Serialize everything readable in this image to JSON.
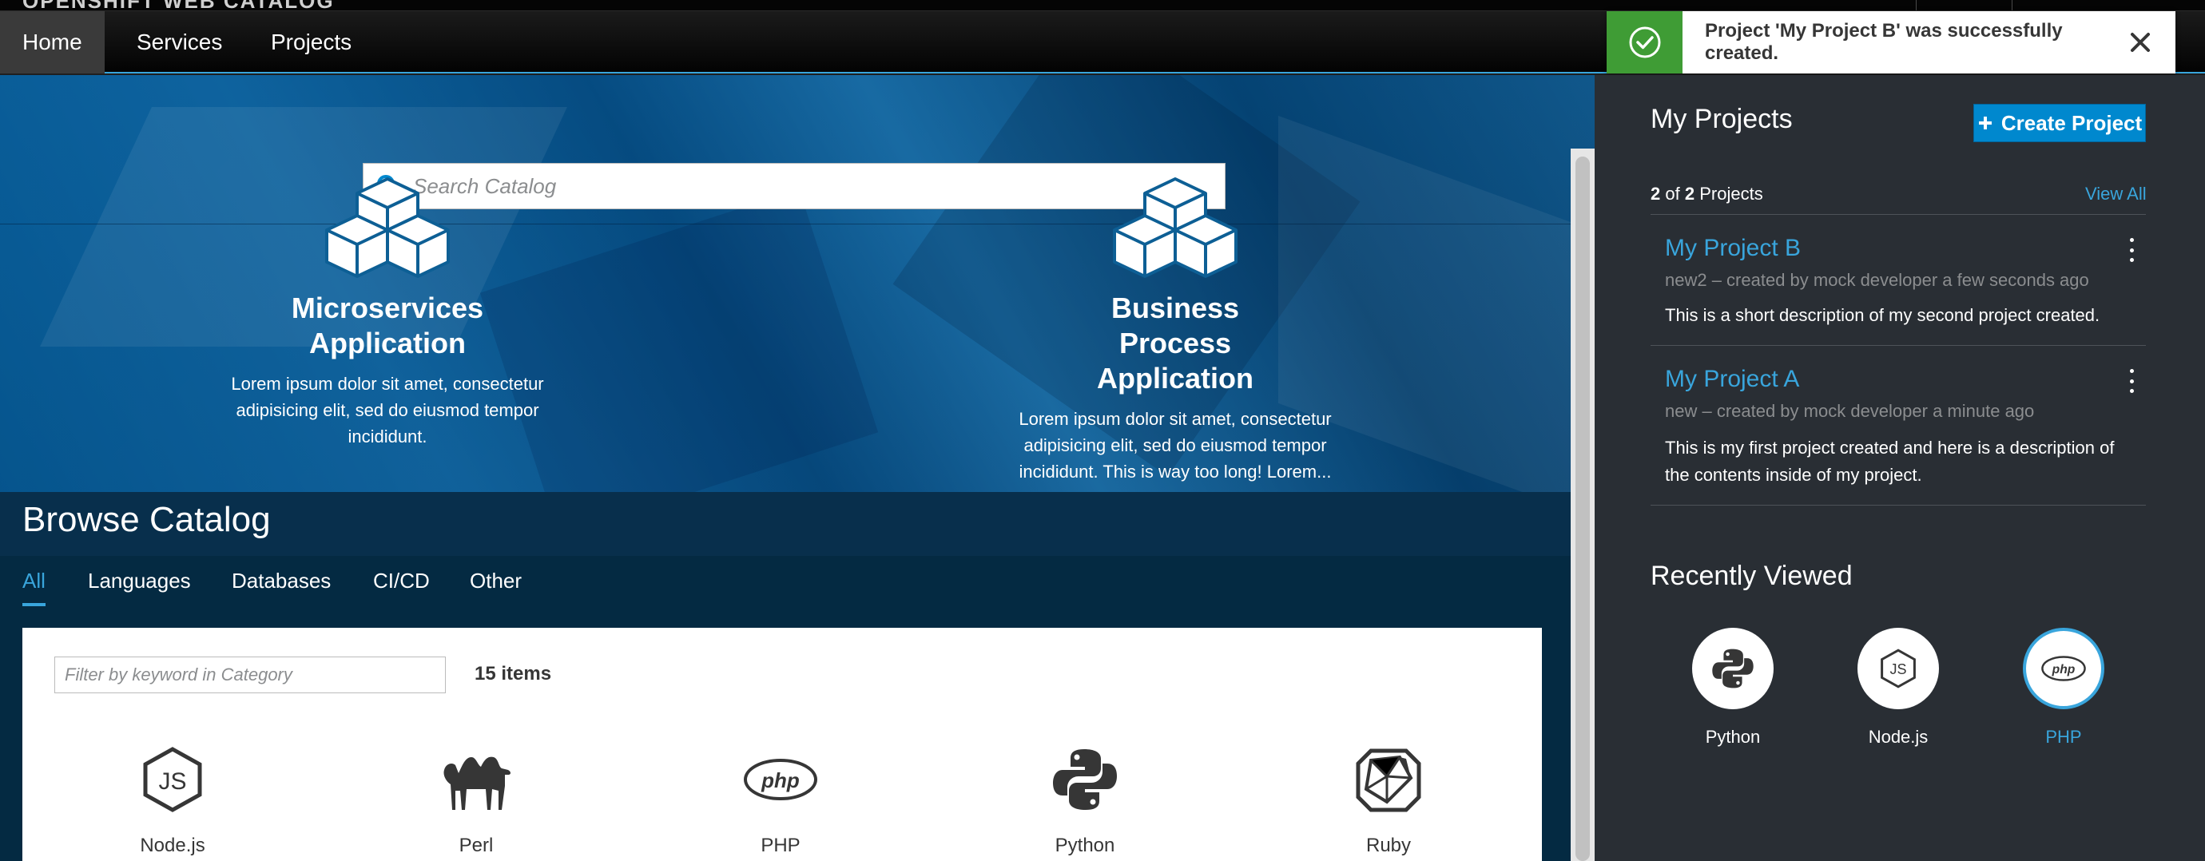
{
  "brand": {
    "text": "OPENSHIFT WEB CATALOG"
  },
  "nav": {
    "items": [
      {
        "label": "Home",
        "active": true
      },
      {
        "label": "Services",
        "active": false
      },
      {
        "label": "Projects",
        "active": false
      }
    ]
  },
  "toast": {
    "message": "Project 'My Project B' was successfully created.",
    "status_icon": "check-circle-icon",
    "close_icon": "close-icon",
    "status_color": "#3f9c35"
  },
  "search": {
    "placeholder": "Search Catalog",
    "value": ""
  },
  "features": [
    {
      "title": "Microservices Application",
      "text": "Lorem ipsum dolor sit amet, consectetur adipisicing elit, sed do eiusmod tempor incididunt.",
      "icon": "cubes-icon"
    },
    {
      "title": "Business Process Application",
      "text": "Lorem ipsum dolor sit amet, consectetur adipisicing elit, sed do eiusmod tempor incididunt. This is way too long! Lorem...",
      "icon": "cubes-icon"
    }
  ],
  "browse": {
    "title": "Browse Catalog",
    "tabs": [
      {
        "label": "All",
        "active": true
      },
      {
        "label": "Languages",
        "active": false
      },
      {
        "label": "Databases",
        "active": false
      },
      {
        "label": "CI/CD",
        "active": false
      },
      {
        "label": "Other",
        "active": false
      }
    ],
    "filter_placeholder": "Filter by keyword in Category",
    "items_count": "15 items",
    "items": [
      {
        "label": "Node.js",
        "icon": "nodejs-icon"
      },
      {
        "label": "Perl",
        "icon": "camel-icon"
      },
      {
        "label": "PHP",
        "icon": "php-icon"
      },
      {
        "label": "Python",
        "icon": "python-icon"
      },
      {
        "label": "Ruby",
        "icon": "ruby-icon"
      }
    ]
  },
  "side": {
    "title": "My Projects",
    "create_label": "Create Project",
    "count_shown": "2",
    "count_of": "of",
    "count_total": "2",
    "count_suffix": "Projects",
    "view_all": "View All",
    "projects": [
      {
        "title": "My Project B",
        "meta": "new2 – created by mock developer a few seconds ago",
        "description": "This is a short description of my second project created."
      },
      {
        "title": "My Project A",
        "meta": "new – created by mock developer a minute ago",
        "description": "This is my first project created and here is a description of the contents inside of my project."
      }
    ],
    "recent_title": "Recently Viewed",
    "recent": [
      {
        "label": "Python",
        "icon": "python-icon",
        "selected": false
      },
      {
        "label": "Node.js",
        "icon": "nodejs-icon",
        "selected": false
      },
      {
        "label": "PHP",
        "icon": "php-icon",
        "selected": true
      }
    ]
  },
  "colors": {
    "accent": "#39a5dc",
    "primary_button": "#0088ce",
    "panel_bg": "#292e34"
  }
}
